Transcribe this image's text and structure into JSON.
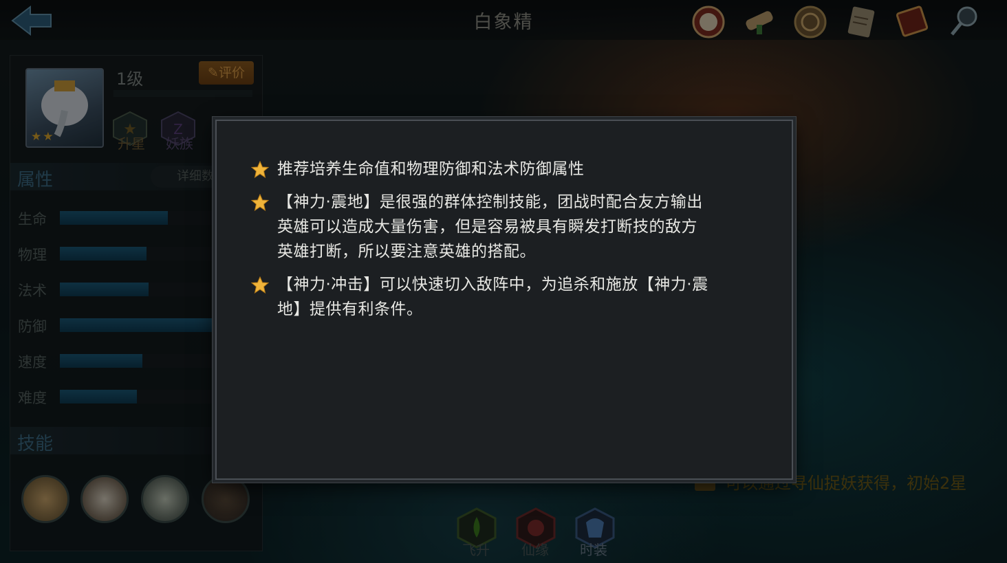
{
  "header": {
    "title": "白象精",
    "back_icon": "arrow-left-icon",
    "icons": [
      "seal-icon",
      "scroll-icon",
      "coin-icon",
      "document-icon",
      "book-icon",
      "magnifier-icon"
    ]
  },
  "hero": {
    "level": "1级",
    "review_label": "评价",
    "star_count": 2,
    "actions": [
      {
        "label": "升星",
        "icon": "star-upgrade-icon"
      },
      {
        "label": "妖族",
        "icon": "clan-icon"
      }
    ]
  },
  "attributes": {
    "title": "属性",
    "detail_label": "详细数",
    "stats": [
      {
        "label": "生命",
        "value": 0.56
      },
      {
        "label": "物理",
        "value": 0.45
      },
      {
        "label": "法术",
        "value": 0.46
      },
      {
        "label": "防御",
        "value": 0.8
      },
      {
        "label": "速度",
        "value": 0.43
      },
      {
        "label": "难度",
        "value": 0.4
      }
    ]
  },
  "skills": {
    "title": "技能",
    "icons": [
      "drum-skill-icon",
      "flower-skill-icon",
      "whirl-skill-icon",
      "beast-skill-icon"
    ]
  },
  "hint": {
    "text": "可以通过寻仙捉妖获得，初始2星"
  },
  "bottom_tabs": [
    {
      "label": "飞升",
      "icon": "ascend-icon"
    },
    {
      "label": "仙缘",
      "icon": "fate-icon"
    },
    {
      "label": "时装",
      "icon": "costume-icon"
    }
  ],
  "tips": [
    "推荐培养生命值和物理防御和法术防御属性",
    "【神力·震地】是很强的群体控制技能，团战时配合友方输出\n英雄可以造成大量伤害，但是容易被具有瞬发打断技的敌方\n英雄打断，所以要注意英雄的搭配。",
    "【神力·冲击】可以快速切入敌阵中，为追杀和施放【神力·震\n地】提供有利条件。"
  ],
  "colors": {
    "star": "#f0b43a",
    "stat_bar": "#1b5876",
    "accent_orange": "#d89a45"
  }
}
